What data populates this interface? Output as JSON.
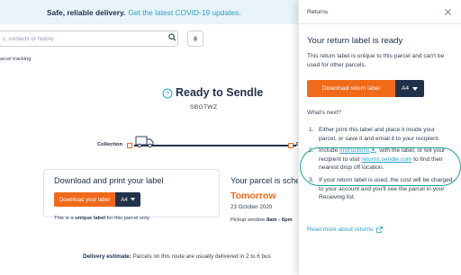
{
  "banner": {
    "text": "Safe, reliable delivery.",
    "link": "Get the latest COVID-19 updates."
  },
  "search": {
    "placeholder": "s, contacts or history"
  },
  "breadcrumb": "arcel tracking",
  "status": {
    "title": "Ready to Sendle",
    "tracking_id": "SBGTWZ",
    "timeline": {
      "start_label": "Collection",
      "end_label": "De"
    }
  },
  "download_card": {
    "title": "Download and print your label",
    "button": "Download your label",
    "size": "A4",
    "note_prefix": "This is a",
    "note_bold": "unique label",
    "note_suffix": "for this parcel only."
  },
  "schedule_card": {
    "title": "Your parcel is schedul",
    "day": "Tomorrow",
    "date": "23 October 2020",
    "window_prefix": "Pickup window",
    "window_value": "8am - 6pm"
  },
  "estimate": {
    "label": "Delivery estimate:",
    "text": "Parcels on this route are usually delivered in 2 to 6 bus"
  },
  "panel": {
    "title": "Returns",
    "heading": "Your return label is ready",
    "description": "This return label is unique to this parcel and can't be used for other parcels.",
    "download_button": "Download return label",
    "size": "A4",
    "next_heading": "What's next?",
    "steps": [
      {
        "num": "1.",
        "text": "Either print this label and place it inside your parcel, or save it and email it to your recipient."
      },
      {
        "num": "2.",
        "pre": "Include",
        "link1": "instructions",
        "mid": "with the label, or tell your recipient to visit",
        "link2": "returns.sendle.com",
        "post": "to find their nearest drop off location."
      },
      {
        "num": "3.",
        "text": "If your return label is used, the cost will be charged to your account and you'll see the parcel in your Receiving list."
      }
    ],
    "more_link": "Read more about returns"
  },
  "colors": {
    "accent": "#f06a1a",
    "navy": "#22314a",
    "link": "#2a9fc6",
    "highlight": "#17a593"
  }
}
